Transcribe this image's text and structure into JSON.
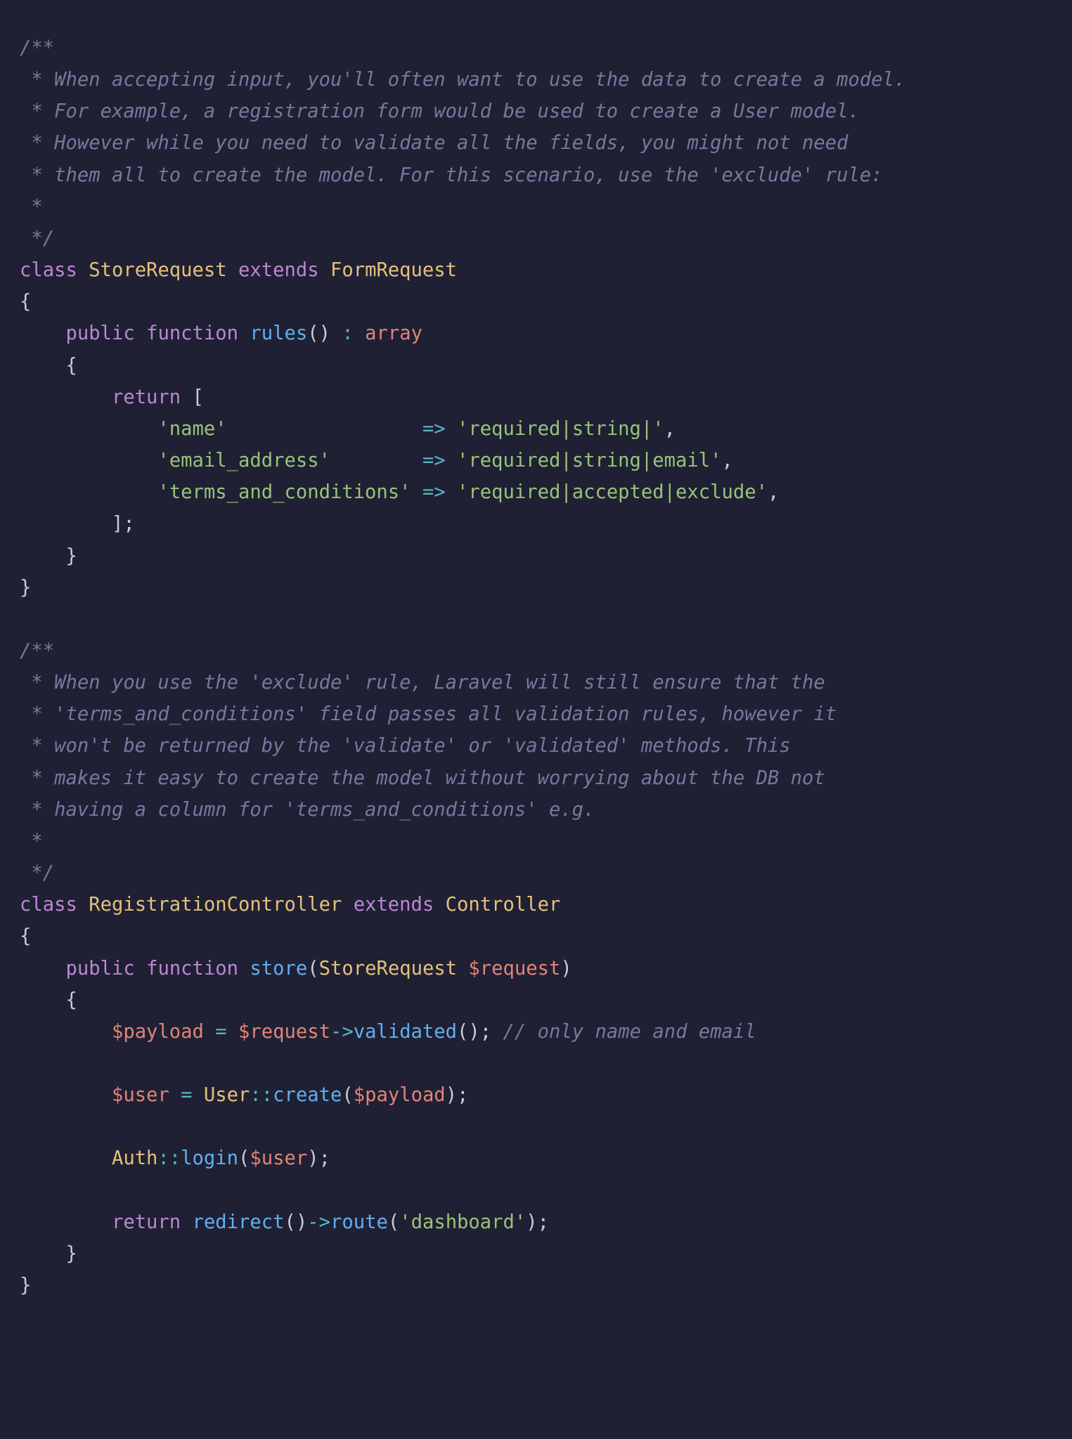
{
  "code": {
    "comment1": {
      "l1": "/**",
      "l2": " * When accepting input, you'll often want to use the data to create a model.",
      "l3": " * For example, a registration form would be used to create a User model.",
      "l4": " * However while you need to validate all the fields, you might not need",
      "l5": " * them all to create the model. For this scenario, use the 'exclude' rule:",
      "l6": " *",
      "l7": " */"
    },
    "kw_class1": "class",
    "cls_StoreRequest": "StoreRequest",
    "kw_extends1": "extends",
    "cls_FormRequest": "FormRequest",
    "brace_open": "{",
    "brace_close": "}",
    "kw_public1": "public",
    "kw_function1": "function",
    "fn_rules": "rules",
    "parens": "()",
    "op_colon": " : ",
    "type_array": "array",
    "kw_return1": "return",
    "bracket_open": "[",
    "bracket_close_semi": "];",
    "rule_keys": {
      "name": "'name'",
      "email": "'email_address'",
      "terms": "'terms_and_conditions'"
    },
    "op_fatarrow": "=>",
    "rule_vals": {
      "name": "'required|string|'",
      "email": "'required|string|email'",
      "terms": "'required|accepted|exclude'"
    },
    "comma": ",",
    "comment2": {
      "l1": "/**",
      "l2": " * When you use the 'exclude' rule, Laravel will still ensure that the",
      "l3": " * 'terms_and_conditions' field passes all validation rules, however it",
      "l4": " * won't be returned by the 'validate' or 'validated' methods. This",
      "l5": " * makes it easy to create the model without worrying about the DB not",
      "l6": " * having a column for 'terms_and_conditions' e.g.",
      "l7": " *",
      "l8": " */"
    },
    "kw_class2": "class",
    "cls_RegistrationController": "RegistrationController",
    "kw_extends2": "extends",
    "cls_Controller": "Controller",
    "kw_public2": "public",
    "kw_function2": "function",
    "fn_store": "store",
    "paren_open": "(",
    "paren_close": ")",
    "cls_StoreRequest2": "StoreRequest",
    "var_request": "$request",
    "var_payload": "$payload",
    "op_assign": " = ",
    "op_arrow": "->",
    "fn_validated": "validated",
    "inline_comment": "// only name and email",
    "var_user": "$user",
    "cls_User": "User",
    "op_dcolon": "::",
    "fn_create": "create",
    "cls_Auth": "Auth",
    "fn_login": "login",
    "kw_return2": "return",
    "fn_redirect": "redirect",
    "fn_route": "route",
    "str_dashboard": "'dashboard'",
    "semi": ";"
  }
}
